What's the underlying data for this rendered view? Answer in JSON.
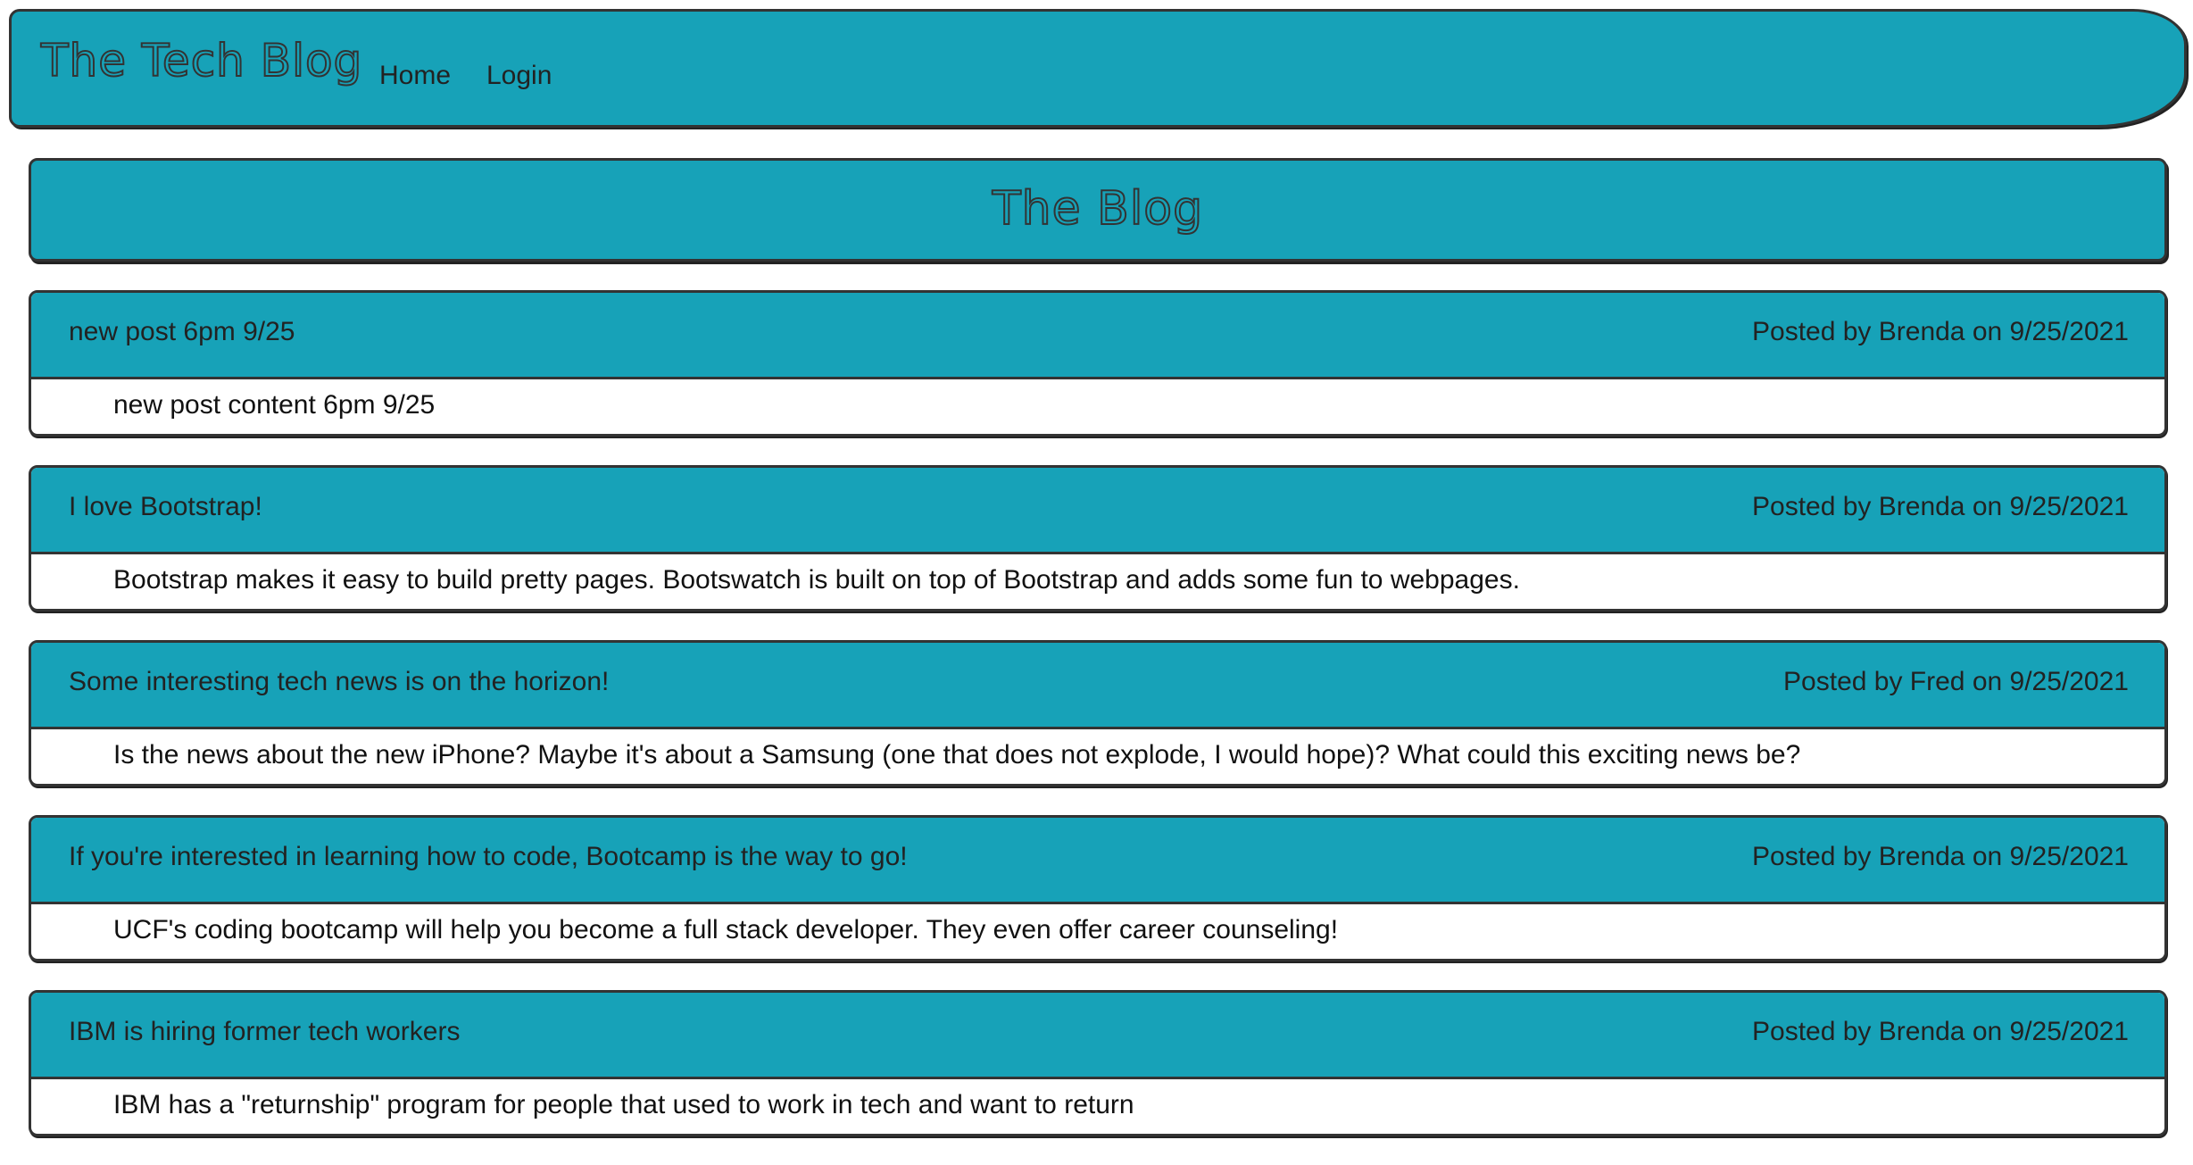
{
  "navbar": {
    "brand": "The Tech Blog",
    "links": {
      "home": "Home",
      "login": "Login"
    }
  },
  "banner": {
    "title": "The Blog"
  },
  "colors": {
    "accent": "#17a2b8",
    "border": "#333333",
    "text": "#222222",
    "background": "#ffffff"
  },
  "posts": [
    {
      "title": "new post 6pm 9/25",
      "meta": "Posted by Brenda on 9/25/2021",
      "content": "new post content 6pm 9/25"
    },
    {
      "title": "I love Bootstrap!",
      "meta": "Posted by Brenda on 9/25/2021",
      "content": "Bootstrap makes it easy to build pretty pages. Bootswatch is built on top of Bootstrap and adds some fun to webpages."
    },
    {
      "title": "Some interesting tech news is on the horizon!",
      "meta": "Posted by Fred on 9/25/2021",
      "content": "Is the news about the new iPhone? Maybe it's about a Samsung (one that does not explode, I would hope)? What could this exciting news be?"
    },
    {
      "title": "If you're interested in learning how to code, Bootcamp is the way to go!",
      "meta": "Posted by Brenda on 9/25/2021",
      "content": "UCF's coding bootcamp will help you become a full stack developer. They even offer career counseling!"
    },
    {
      "title": "IBM is hiring former tech workers",
      "meta": "Posted by Brenda on 9/25/2021",
      "content": "IBM has a \"returnship\" program for people that used to work in tech and want to return"
    }
  ]
}
